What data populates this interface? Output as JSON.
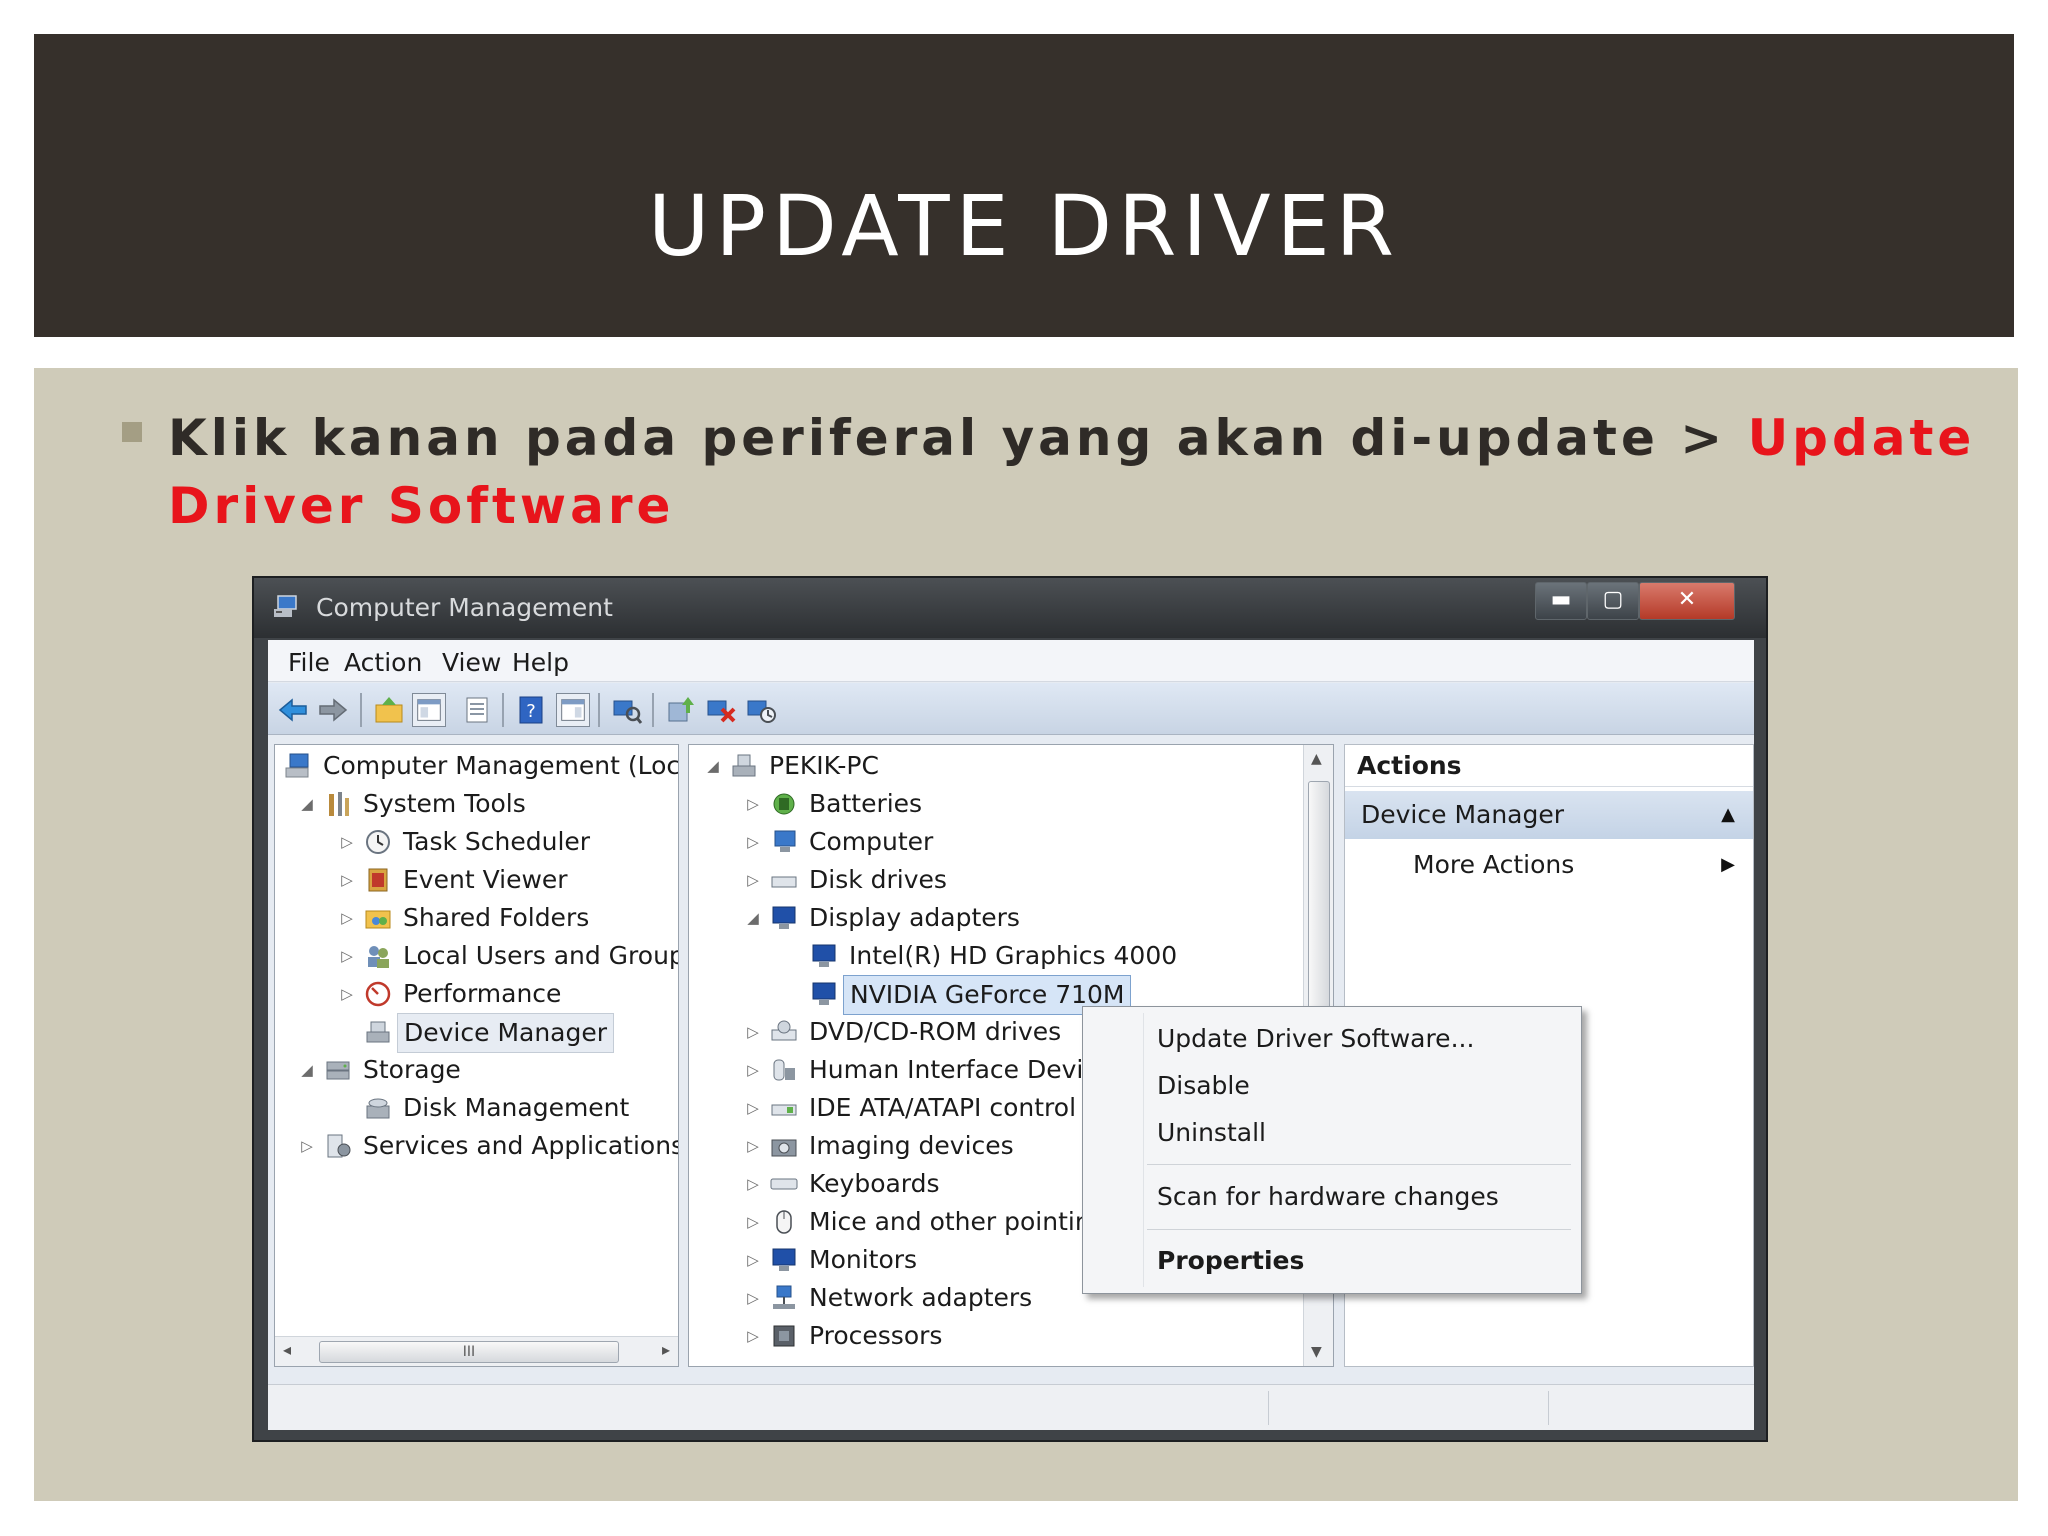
{
  "slide": {
    "title": "UPDATE DRIVER",
    "bullet_text": "Klik kanan pada periferal yang akan di-update > ",
    "bullet_highlight": "Update Driver Software",
    "highlight_color": "#e8141b"
  },
  "window": {
    "title": "Computer Management",
    "controls": {
      "minimize": "▬",
      "maximize": "▢",
      "close": "✕"
    },
    "menu": [
      "File",
      "Action",
      "View",
      "Help"
    ],
    "toolbar_icons": [
      "back-icon",
      "forward-icon",
      "up-folder-icon",
      "show-hide-tree-icon",
      "properties-icon",
      "help-icon",
      "show-hide-action-pane-icon",
      "scan-hardware-icon",
      "update-driver-icon",
      "uninstall-icon",
      "enable-device-icon"
    ]
  },
  "tree": {
    "root": "Computer Management (Local",
    "system_tools": "System Tools",
    "task_scheduler": "Task Scheduler",
    "event_viewer": "Event Viewer",
    "shared_folders": "Shared Folders",
    "local_users": "Local Users and Groups",
    "performance": "Performance",
    "device_manager": "Device Manager",
    "storage": "Storage",
    "disk_management": "Disk Management",
    "services_apps": "Services and Applications",
    "scroll_grip": "III"
  },
  "devices": {
    "computer_name": "PEKIK-PC",
    "batteries": "Batteries",
    "computer": "Computer",
    "disk_drives": "Disk drives",
    "display_adapters": "Display adapters",
    "intel": "Intel(R) HD Graphics 4000",
    "nvidia": "NVIDIA GeForce 710M",
    "dvd": "DVD/CD-ROM drives",
    "hid": "Human Interface Devic",
    "ide": "IDE ATA/ATAPI control",
    "imaging": "Imaging devices",
    "keyboards": "Keyboards",
    "mice": "Mice and other pointin",
    "monitors": "Monitors",
    "network": "Network adapters",
    "processors": "Processors"
  },
  "actions": {
    "header": "Actions",
    "section": "Device Manager",
    "more": "More Actions"
  },
  "context_menu": {
    "update": "Update Driver Software...",
    "disable": "Disable",
    "uninstall": "Uninstall",
    "scan": "Scan for hardware changes",
    "properties": "Properties"
  }
}
